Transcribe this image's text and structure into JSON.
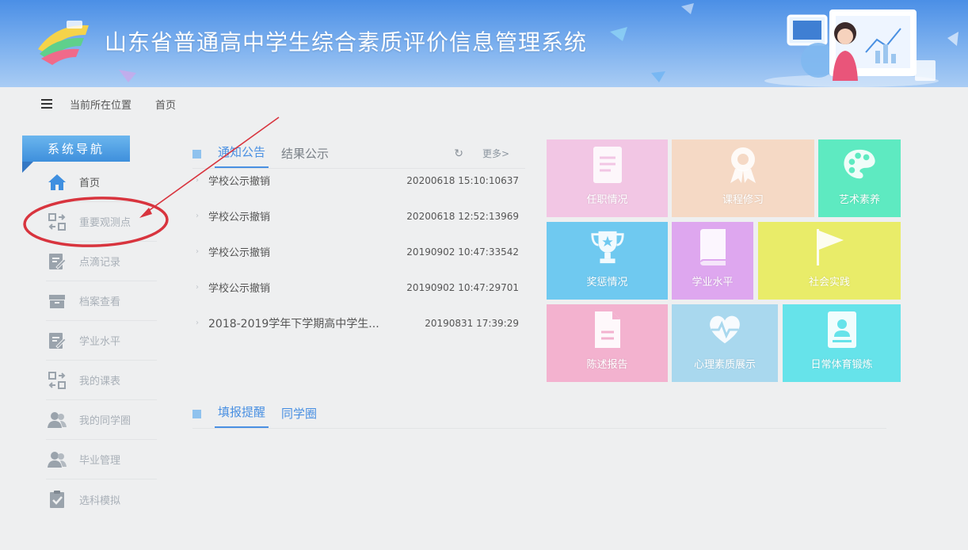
{
  "header": {
    "title": "山东省普通高中学生综合素质评价信息管理系统"
  },
  "breadcrumb": {
    "label": "当前所在位置",
    "current": "首页"
  },
  "sidebar": {
    "title": "系统导航",
    "items": [
      {
        "label": "首页",
        "icon": "home-icon"
      },
      {
        "label": "重要观测点",
        "icon": "swap-icon"
      },
      {
        "label": "点滴记录",
        "icon": "edit-icon"
      },
      {
        "label": "档案查看",
        "icon": "archive-icon"
      },
      {
        "label": "学业水平",
        "icon": "edit-icon"
      },
      {
        "label": "我的课表",
        "icon": "swap-icon"
      },
      {
        "label": "我的同学圈",
        "icon": "users-icon"
      },
      {
        "label": "毕业管理",
        "icon": "users-icon"
      },
      {
        "label": "选科模拟",
        "icon": "clipboard-check-icon"
      }
    ]
  },
  "notices": {
    "tabs": [
      "通知公告",
      "结果公示"
    ],
    "more": "更多>",
    "rows": [
      {
        "title": "学校公示撤销",
        "date": "20200618 15:10:10637"
      },
      {
        "title": "学校公示撤销",
        "date": "20200618 12:52:13969"
      },
      {
        "title": "学校公示撤销",
        "date": "20190902 10:47:33542"
      },
      {
        "title": "学校公示撤销",
        "date": "20190902 10:47:29701"
      },
      {
        "title": "2018-2019学年下学期高中学生...",
        "date": "20190831 17:39:29"
      }
    ]
  },
  "reminders": {
    "tabs": [
      "填报提醒",
      "同学圈"
    ]
  },
  "tiles": [
    {
      "label": "任职情况",
      "color": "#f2c6e4",
      "icon": "document-icon"
    },
    {
      "label": "课程修习",
      "color": "#f5d9c5",
      "icon": "ribbon-icon"
    },
    {
      "label": "艺术素养",
      "color": "#5eeac1",
      "icon": "palette-icon"
    },
    {
      "label": "奖惩情况",
      "color": "#6fc9f0",
      "icon": "trophy-icon"
    },
    {
      "label": "学业水平",
      "color": "#dea7ef",
      "icon": "book-icon"
    },
    {
      "label": "社会实践",
      "color": "#e9ec69",
      "icon": "flag-icon"
    },
    {
      "label": "陈述报告",
      "color": "#f3b2cf",
      "icon": "report-icon"
    },
    {
      "label": "心理素质展示",
      "color": "#a9d8ee",
      "icon": "heart-icon"
    },
    {
      "label": "日常体育锻炼",
      "color": "#66e3ea",
      "icon": "id-card-icon"
    }
  ],
  "colors": {
    "accent": "#4a90e2",
    "annotation": "#d8343e",
    "header": "#5b9ae6"
  }
}
